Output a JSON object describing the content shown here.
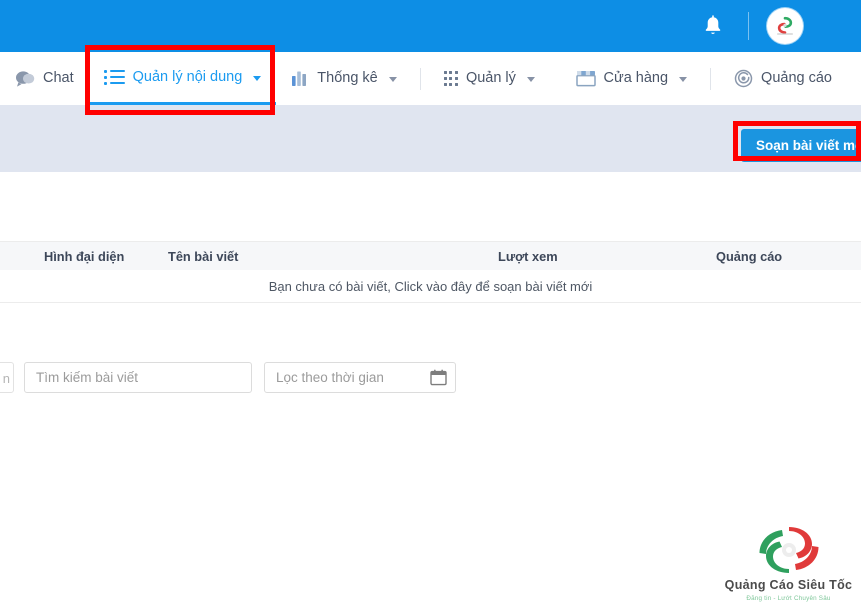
{
  "topbar": {
    "notification_icon": "bell-icon",
    "avatar_label": "user-avatar",
    "background_color": "#0d8ee5"
  },
  "nav": {
    "items": [
      {
        "label": "Chat",
        "icon": "chat-bubble-icon",
        "has_caret": false,
        "active": false
      },
      {
        "label": "Quản lý nội dung",
        "icon": "list-icon",
        "has_caret": true,
        "active": true
      },
      {
        "label": "Thống kê",
        "icon": "bar-chart-icon",
        "has_caret": true,
        "active": false
      },
      {
        "label": "Quản lý",
        "icon": "grid-dots-icon",
        "has_caret": true,
        "active": false
      }
    ],
    "right_items": [
      {
        "label": "Cửa hàng",
        "icon": "store-icon",
        "has_caret": true,
        "active": false
      },
      {
        "label": "Quảng cáo",
        "icon": "target-icon",
        "has_caret": false,
        "active": false
      }
    ],
    "active_color": "#1b9bf0"
  },
  "toolbar": {
    "new_post_label": "Soạn bài viết mới",
    "button_color": "#1b95e0",
    "band_color": "#e0e5f0"
  },
  "filters": {
    "left_stub_text": "n",
    "search_placeholder": "Tìm kiếm bài viết",
    "search_value": "",
    "date_placeholder": "Lọc theo thời gian",
    "date_value": "",
    "calendar_icon": "calendar-icon"
  },
  "table": {
    "columns": [
      "Hình đại diện",
      "Tên bài viết",
      "Lượt xem",
      "Quảng cáo"
    ],
    "rows": [],
    "empty_message": "Bạn chưa có bài viết, Click vào đây để soạn bài viết mới"
  },
  "brand": {
    "name": "Quảng Cáo Siêu Tốc",
    "tagline": "Đăng tin - Lướt Chuyên Sâu"
  },
  "annotations": {
    "color": "#ff0000",
    "boxes": [
      "nav-item-quan-ly-noi-dung",
      "new-post-button"
    ]
  }
}
